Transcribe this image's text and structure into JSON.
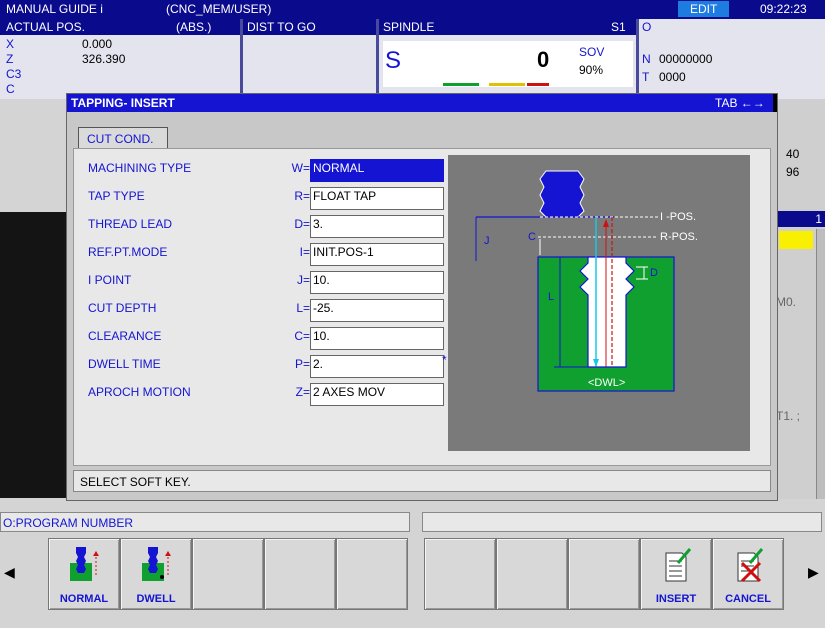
{
  "titlebar": {
    "app": "MANUAL GUIDE i",
    "path": "(CNC_MEM/USER)",
    "mode": "EDIT",
    "time": "09:22:23"
  },
  "actual_pos": {
    "title": "ACTUAL POS.",
    "mode": "(ABS.)",
    "axes": [
      {
        "axis": "X",
        "value": "0.000"
      },
      {
        "axis": "Z",
        "value": "326.390"
      },
      {
        "axis": "C3",
        "value": ""
      },
      {
        "axis": "C",
        "value": ""
      }
    ]
  },
  "dist_to_go": {
    "title": "DIST TO GO"
  },
  "spindle": {
    "title": "SPINDLE",
    "id": "S1",
    "letter": "S",
    "value": "0",
    "sov_label": "SOV",
    "sov_value": "90%"
  },
  "program": {
    "o_label": "O",
    "n_label": "N",
    "n_value": "00000000",
    "t_label": "T",
    "t_value": "0000"
  },
  "right_panel": {
    "v1": "40",
    "v2": "96",
    "v3": "1",
    "v4": "M0.",
    "v5": "T1. ;"
  },
  "dialog": {
    "title": "TAPPING- INSERT",
    "tab_switch": "TAB ←→",
    "tab": "CUT COND.",
    "fields": [
      {
        "label": "MACHINING TYPE",
        "letter": "W=",
        "value": "NORMAL",
        "selected": true
      },
      {
        "label": "TAP TYPE",
        "letter": "R=",
        "value": "FLOAT TAP"
      },
      {
        "label": "THREAD LEAD",
        "letter": "D=",
        "value": "3."
      },
      {
        "label": "REF.PT.MODE",
        "letter": "I=",
        "value": "INIT.POS-1"
      },
      {
        "label": "I POINT",
        "letter": "J=",
        "value": "10."
      },
      {
        "label": "CUT DEPTH",
        "letter": "L=",
        "value": "-25."
      },
      {
        "label": "CLEARANCE",
        "letter": "C=",
        "value": "10."
      },
      {
        "label": "DWELL TIME",
        "letter": "P=",
        "value": "2."
      },
      {
        "label": "APROCH MOTION",
        "letter": "Z=",
        "value": "2 AXES MOV"
      }
    ],
    "dwell_marker": "*",
    "diagram": {
      "i_pos": "I -POS.",
      "r_pos": "R-POS.",
      "j": "J",
      "c": "C",
      "l": "L",
      "d": "D",
      "dwl": "<DWL>"
    },
    "message": "SELECT SOFT KEY."
  },
  "status": {
    "left": "O:PROGRAM NUMBER",
    "right": ""
  },
  "softkeys": [
    {
      "label": "NORMAL",
      "icon": "tap-normal-icon"
    },
    {
      "label": "DWELL",
      "icon": "tap-dwell-icon"
    },
    {
      "label": ""
    },
    {
      "label": ""
    },
    {
      "label": ""
    },
    {
      "label": ""
    },
    {
      "label": ""
    },
    {
      "label": ""
    },
    {
      "label": "INSERT",
      "icon": "insert-document-icon"
    },
    {
      "label": "CANCEL",
      "icon": "cancel-document-icon"
    }
  ],
  "colors": {
    "title_navy": "#0a0a8c",
    "selection_blue": "#1414d2",
    "label_blue": "#1414d2",
    "edit_badge": "#1e7be0",
    "diagram_green": "#10a030"
  }
}
